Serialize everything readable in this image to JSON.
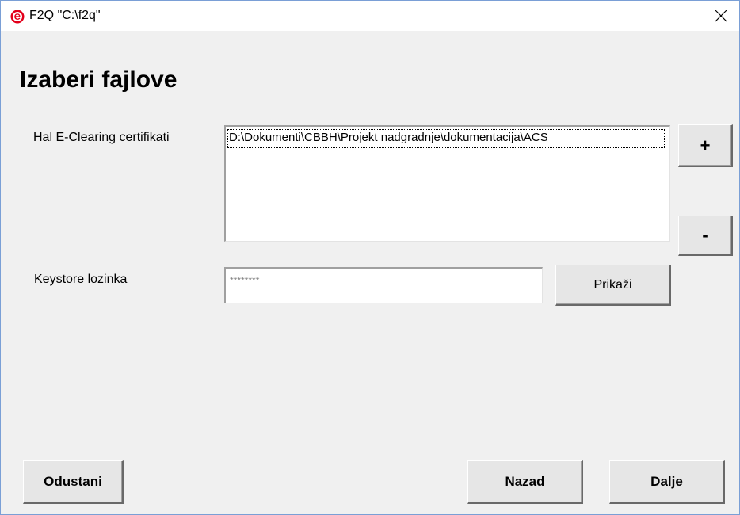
{
  "window": {
    "title": "F2Q \"C:\\f2q\"",
    "icon": "app-e-icon",
    "close_icon": "close-icon",
    "accent_color": "#e3001b"
  },
  "page": {
    "heading": "Izaberi fajlove"
  },
  "certificates": {
    "label": "Hal E-Clearing certifikati",
    "items": [
      "D:\\Dokumenti\\CBBH\\Projekt nadgradnje\\dokumentacija\\ACS"
    ],
    "add_label": "+",
    "remove_label": "-"
  },
  "keystore": {
    "label": "Keystore lozinka",
    "value": "********",
    "show_label": "Prikaži"
  },
  "footer": {
    "cancel_label": "Odustani",
    "back_label": "Nazad",
    "next_label": "Dalje"
  }
}
